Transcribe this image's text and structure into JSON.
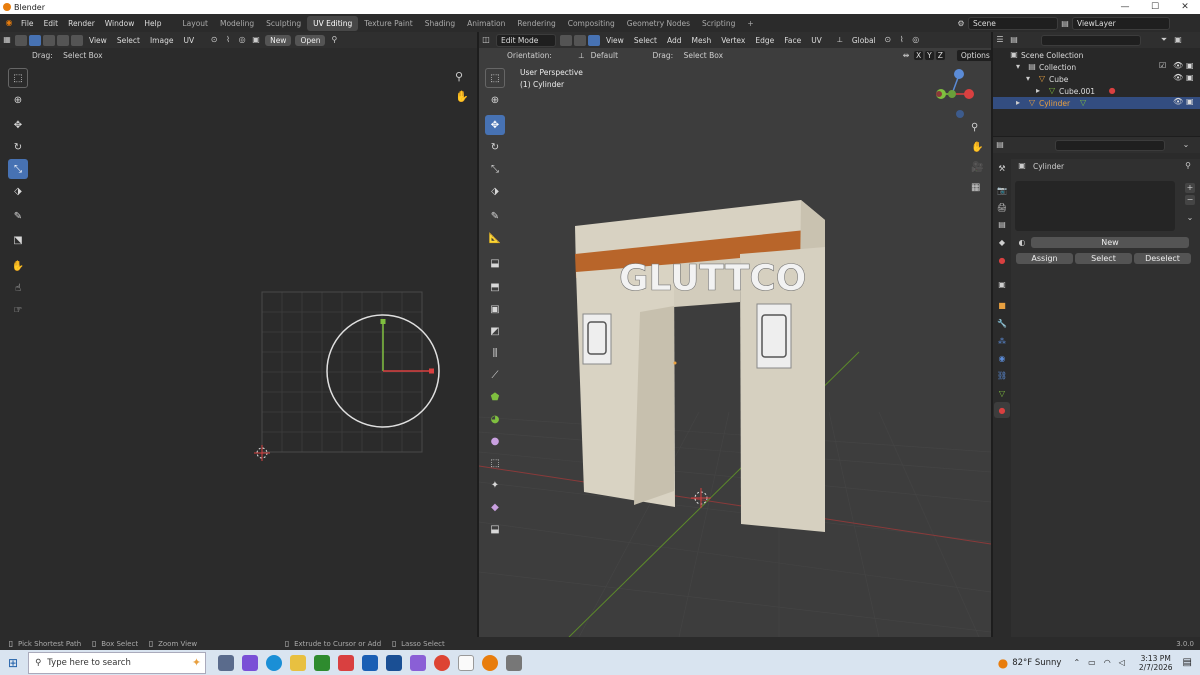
{
  "window": {
    "title": "Blender"
  },
  "menu": [
    "File",
    "Edit",
    "Render",
    "Window",
    "Help"
  ],
  "workspaces": [
    "Layout",
    "Modeling",
    "Sculpting",
    "UV Editing",
    "Texture Paint",
    "Shading",
    "Animation",
    "Rendering",
    "Compositing",
    "Geometry Nodes",
    "Scripting",
    "+"
  ],
  "active_workspace": "UV Editing",
  "scene": {
    "name": "Scene",
    "view_layer": "ViewLayer"
  },
  "uv_editor": {
    "menus": [
      "View",
      "Select",
      "Image",
      "UV"
    ],
    "new_label": "New",
    "open_label": "Open",
    "drag_label": "Drag:",
    "drag_value": "Select Box"
  },
  "viewport": {
    "mode": "Edit Mode",
    "menus": [
      "View",
      "Select",
      "Add",
      "Mesh",
      "Vertex",
      "Edge",
      "Face",
      "UV"
    ],
    "transform": "Global",
    "orientation_label": "Orientation:",
    "orientation_value": "Default",
    "drag_label": "Drag:",
    "drag_value": "Select Box",
    "options_label": "Options",
    "axes": [
      "X",
      "Y",
      "Z"
    ],
    "overlay_title": "User Perspective",
    "overlay_object": "(1) Cylinder",
    "sign_text": "GLUTTCO"
  },
  "outliner": {
    "rows": [
      {
        "label": "Scene Collection"
      },
      {
        "label": "Collection"
      },
      {
        "label": "Cube"
      },
      {
        "label": "Cube.001"
      },
      {
        "label": "Cylinder"
      }
    ]
  },
  "properties": {
    "object_name": "Cylinder",
    "new_label": "New",
    "assign_label": "Assign",
    "select_label": "Select",
    "deselect_label": "Deselect"
  },
  "status": {
    "items": [
      "Pick Shortest Path",
      "Box Select",
      "Zoom View",
      "Extrude to Cursor or Add",
      "Lasso Select"
    ],
    "version": "3.0.0"
  },
  "taskbar": {
    "search_placeholder": "Type here to search",
    "weather": "82°F  Sunny",
    "time": "3:13 PM",
    "date": "2/7/2026"
  },
  "colors": {
    "accent": "#4772b3",
    "orange": "#e87d0d"
  }
}
